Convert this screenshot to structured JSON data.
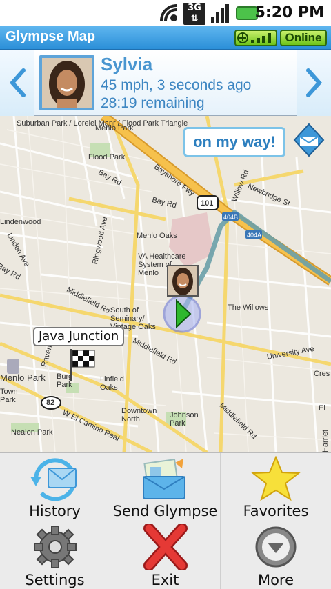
{
  "status_bar": {
    "time": "5:20 PM",
    "network": "3G"
  },
  "title_bar": {
    "title": "Glympse Map",
    "status": "Online"
  },
  "contact": {
    "name": "Sylvia",
    "speed_line": "45 mph, 3 seconds ago",
    "remaining": "28:19 remaining"
  },
  "map": {
    "callout": "on my way!",
    "place_label": "Java Junction",
    "labels": {
      "suburban": "Suburban Park / Lorelei Manr / Flood Park Triangle",
      "menlo_park_top": "Menlo Park",
      "flood_park": "Flood Park",
      "bay_rd_1": "Bay Rd",
      "bayshore": "Bayshore Fwy",
      "willow": "Willow Rd",
      "newbridge": "Newbridge St",
      "bay_rd_2": "Bay Rd",
      "hwy101": "101",
      "exit404b": "404B",
      "exit404a": "404A",
      "lindenwood": "Lindenwood",
      "linden_ave": "Linden Ave",
      "menlo_oaks": "Menlo Oaks",
      "ringwood": "Ringwood Ave",
      "va": "VA Healthcare System of Menlo",
      "bay_rd_3": "Bay Rd",
      "willows": "The Willows",
      "south_seminary": "South of Seminary/ Vintage Oaks",
      "middlefield_1": "Middlefield Rd",
      "middlefield_2": "Middlefield Rd",
      "university": "University Ave",
      "menlo_park_left": "Menlo Park",
      "town": "Town Park",
      "linfield": "Linfield Oaks",
      "burg": "Burg Park",
      "hwy82": "82",
      "el_camino": "W El Camino Real",
      "downtown": "Downtown North",
      "johnson": "Johnson Park",
      "nealon": "Nealon Park",
      "middlefield_3": "Middlefield Rd",
      "cres": "Cres",
      "el_right": "El",
      "ravens": "Ravens",
      "harriet": "Harriet"
    }
  },
  "menu": {
    "items": [
      {
        "label": "History",
        "icon": "history-icon"
      },
      {
        "label": "Send Glympse",
        "icon": "send-glympse-icon"
      },
      {
        "label": "Favorites",
        "icon": "star-icon"
      },
      {
        "label": "Settings",
        "icon": "gear-icon"
      },
      {
        "label": "Exit",
        "icon": "close-icon"
      },
      {
        "label": "More",
        "icon": "chevron-down-icon"
      }
    ]
  },
  "colors": {
    "title_bar": "#2b8fd8",
    "online_badge": "#6ec41b",
    "accent_text": "#3d86c2",
    "highway": "#f6c14c",
    "route": "#6aa0a8"
  }
}
